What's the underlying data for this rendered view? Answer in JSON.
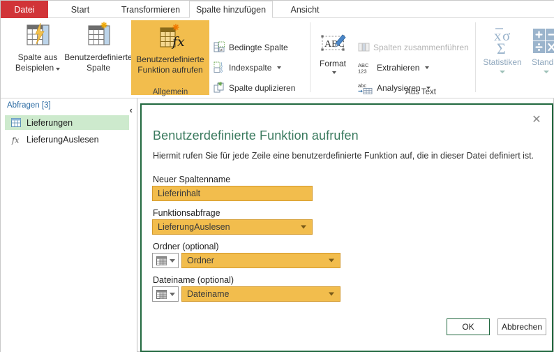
{
  "window": {
    "tabs": [
      {
        "id": "datei",
        "label": "Datei"
      },
      {
        "id": "start",
        "label": "Start"
      },
      {
        "id": "transformieren",
        "label": "Transformieren"
      },
      {
        "id": "spalte-hinzufuegen",
        "label": "Spalte hinzufügen"
      },
      {
        "id": "ansicht",
        "label": "Ansicht"
      }
    ],
    "active_tab": "Spalte hinzufügen"
  },
  "ribbon": {
    "groups": [
      {
        "id": "allgemein",
        "label": "Allgemein"
      },
      {
        "id": "aus-text",
        "label": "Aus Text"
      }
    ],
    "big_buttons": [
      {
        "id": "spalte-aus-beispielen",
        "label_line1": "Spalte aus",
        "label_line2": "Beispielen",
        "has_caret": true,
        "selected": false
      },
      {
        "id": "benutzerdefinierte-spalte",
        "label_line1": "Benutzerdefinierte",
        "label_line2": "Spalte",
        "has_caret": false,
        "selected": false
      },
      {
        "id": "benutzerdefinierte-funktion-aufrufen",
        "label_line1": "Benutzerdefinierte",
        "label_line2": "Funktion aufrufen",
        "has_caret": false,
        "selected": true
      },
      {
        "id": "format",
        "label_line1": "Format",
        "label_line2": "",
        "has_caret": true,
        "selected": false
      },
      {
        "id": "statistiken",
        "label_line1": "Statistiken",
        "label_line2": "",
        "has_caret": true,
        "selected": false
      },
      {
        "id": "standard",
        "label_line1": "Standar",
        "label_line2": "",
        "has_caret": true,
        "selected": false
      }
    ],
    "small_buttons": [
      {
        "id": "bedingte-spalte",
        "label": "Bedingte Spalte",
        "has_caret": false,
        "disabled": false
      },
      {
        "id": "indexspalte",
        "label": "Indexspalte",
        "has_caret": true,
        "disabled": false
      },
      {
        "id": "spalte-duplizieren",
        "label": "Spalte duplizieren",
        "has_caret": false,
        "disabled": false
      },
      {
        "id": "spalten-zusammenfuehren",
        "label": "Spalten zusammenführen",
        "has_caret": false,
        "disabled": true
      },
      {
        "id": "extrahieren",
        "label": "Extrahieren",
        "has_caret": true,
        "disabled": false
      },
      {
        "id": "analysieren",
        "label": "Analysieren",
        "has_caret": true,
        "disabled": false
      }
    ]
  },
  "query_pane": {
    "header": "Abfragen [3]",
    "items": [
      {
        "id": "lieferungen",
        "label": "Lieferungen",
        "icon": "table-icon",
        "selected": true
      },
      {
        "id": "lieferungauslesen",
        "label": "LieferungAuslesen",
        "icon": "function-fx-icon",
        "selected": false
      }
    ]
  },
  "dialog": {
    "title": "Benutzerdefinierte Funktion aufrufen",
    "description": "Hiermit rufen Sie für jede Zeile eine benutzerdefinierte Funktion auf, die in dieser Datei definiert ist.",
    "close_label": "✕",
    "fields": [
      {
        "id": "neuer-spaltenname",
        "label": "Neuer Spaltenname",
        "value": "Lieferinhalt",
        "control": "text"
      },
      {
        "id": "funktionsabfrage",
        "label": "Funktionsabfrage",
        "value": "LieferungAuslesen",
        "control": "select"
      },
      {
        "id": "ordner",
        "label": "Ordner (optional)",
        "value": "Ordner",
        "control": "select-with-type"
      },
      {
        "id": "dateiname",
        "label": "Dateiname (optional)",
        "value": "Dateiname",
        "control": "select-with-type"
      }
    ],
    "buttons": [
      {
        "id": "ok",
        "label": "OK",
        "primary": true
      },
      {
        "id": "abbrechen",
        "label": "Abbrechen",
        "primary": false
      }
    ]
  },
  "colors": {
    "accent_red": "#d13438",
    "amber": "#f2bd4d",
    "amber_border": "#d49a2c",
    "dialog_border": "#21683f",
    "dialog_title": "#3a7a5e",
    "selection_green": "#cdeacd",
    "query_header": "#2e6da4"
  }
}
